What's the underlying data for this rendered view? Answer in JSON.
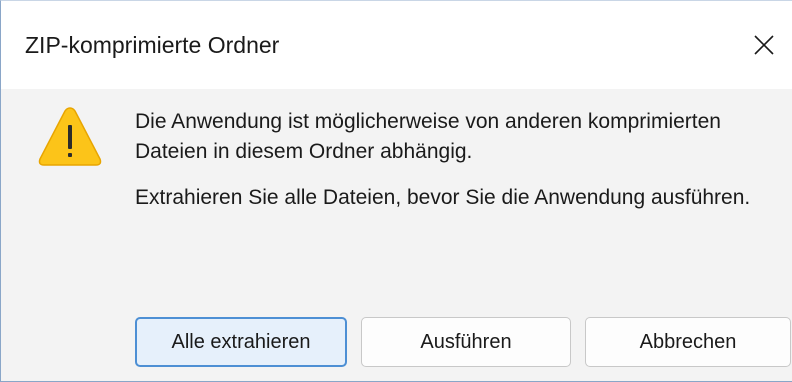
{
  "dialog": {
    "title": "ZIP-komprimierte Ordner",
    "close_icon": "close-icon",
    "warning_icon": "warning-icon",
    "message_line1": "Die Anwendung ist möglicherweise von anderen komprimierten Dateien in diesem Ordner abhängig.",
    "message_line2": "Extrahieren Sie alle Dateien, bevor Sie die Anwendung ausführen."
  },
  "buttons": {
    "extract_all": "Alle extrahieren",
    "run": "Ausführen",
    "cancel": "Abbrechen"
  },
  "colors": {
    "warning_fill": "#fcc419",
    "warning_stroke": "#e8a500",
    "primary_button_border": "#4d8fd4",
    "primary_button_bg": "#e6f0fb"
  }
}
